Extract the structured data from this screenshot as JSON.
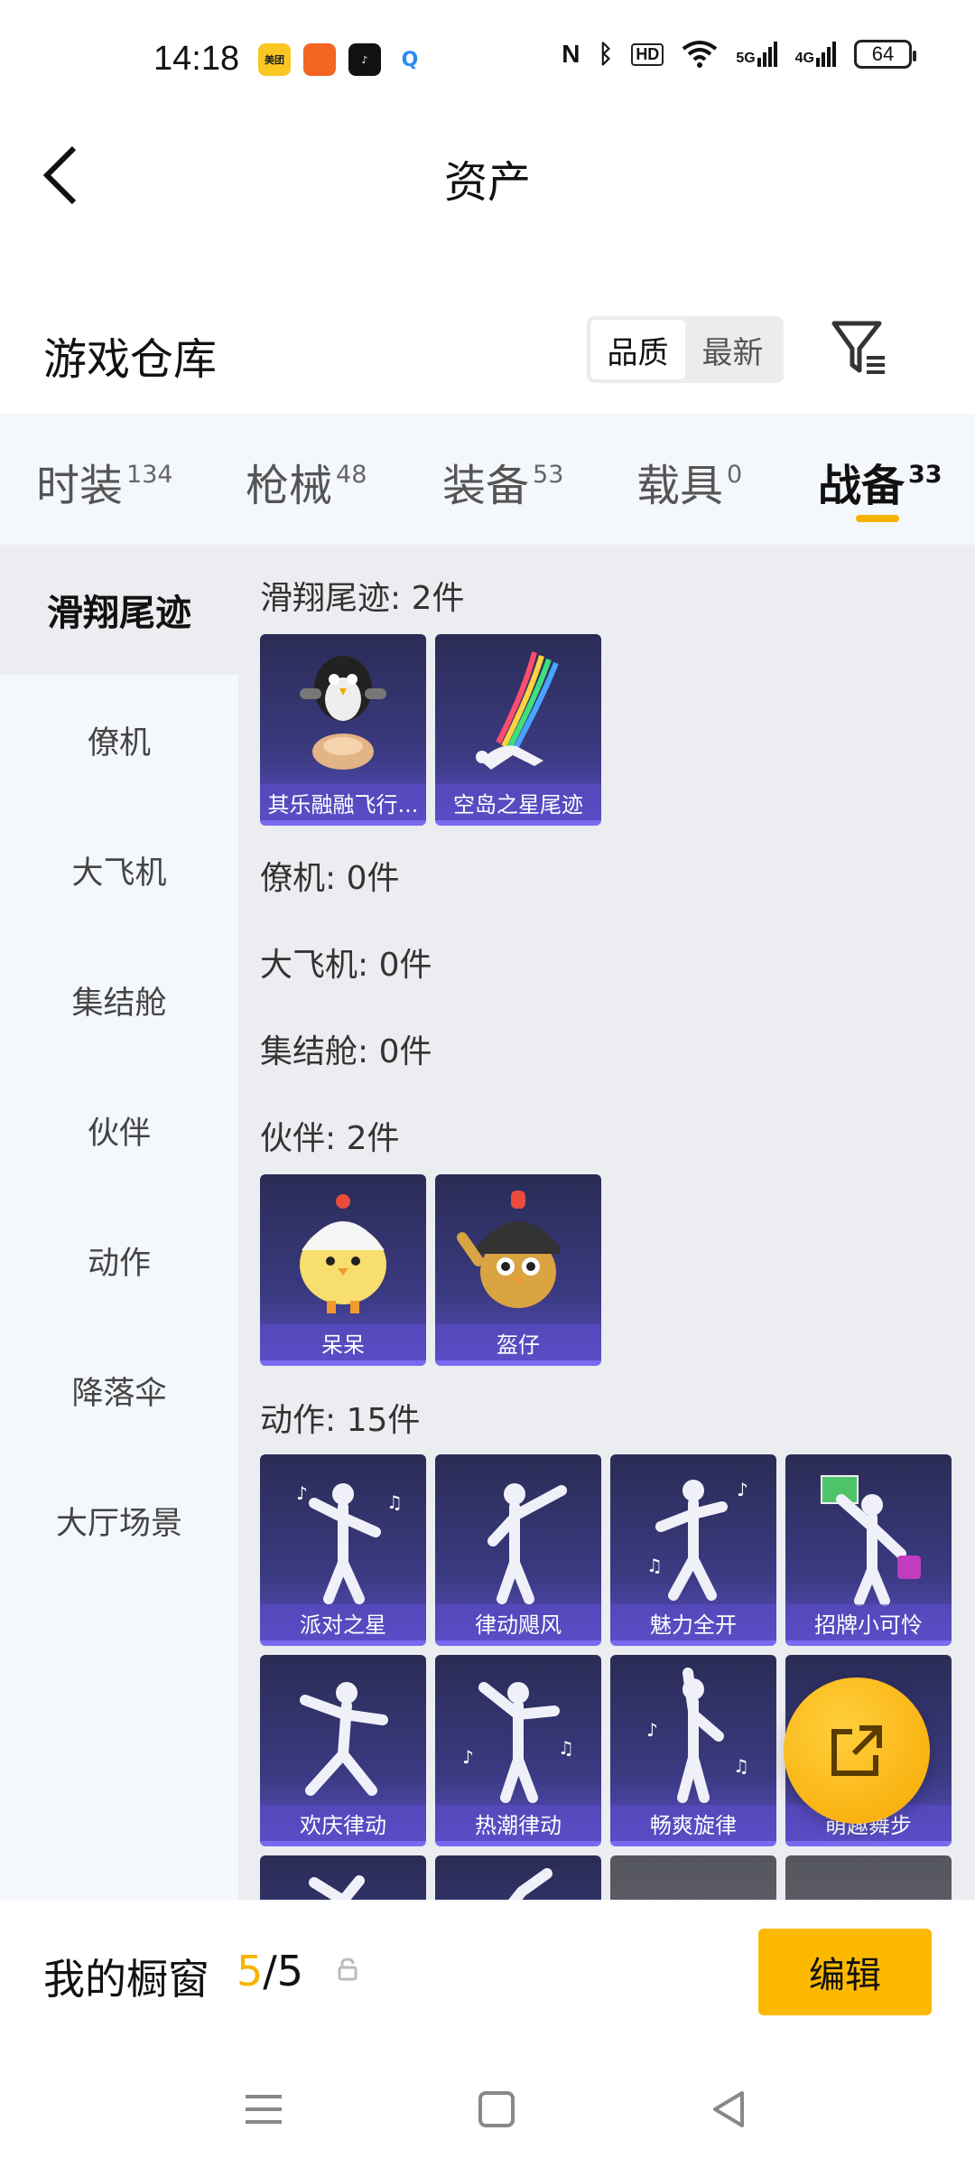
{
  "status_bar": {
    "time": "14:18",
    "app_icons": [
      "美团",
      "app-icon",
      "tiktok-icon",
      "search-app-icon"
    ],
    "signal_5g": "5G",
    "signal_4g": "4G",
    "battery": "64"
  },
  "header": {
    "title": "资产",
    "back_icon": "chevron-left-icon"
  },
  "warehouse": {
    "title": "游戏仓库",
    "sort_options": [
      "品质",
      "最新"
    ],
    "sort_selected": "品质",
    "filter_icon": "filter-icon"
  },
  "tabs": [
    {
      "label": "时装",
      "count": "134",
      "active": false
    },
    {
      "label": "枪械",
      "count": "48",
      "active": false
    },
    {
      "label": "装备",
      "count": "53",
      "active": false
    },
    {
      "label": "载具",
      "count": "0",
      "active": false
    },
    {
      "label": "战备",
      "count": "33",
      "active": true
    }
  ],
  "accent_color": "#f6b400",
  "subnav": [
    {
      "label": "滑翔尾迹",
      "active": true
    },
    {
      "label": "僚机",
      "active": false
    },
    {
      "label": "大飞机",
      "active": false
    },
    {
      "label": "集结舱",
      "active": false
    },
    {
      "label": "伙伴",
      "active": false
    },
    {
      "label": "动作",
      "active": false
    },
    {
      "label": "降落伞",
      "active": false
    },
    {
      "label": "大厅场景",
      "active": false
    }
  ],
  "sections": [
    {
      "title": "滑翔尾迹: 2件",
      "items": [
        "其乐融融飞行...",
        "空岛之星尾迹"
      ]
    },
    {
      "title": "僚机: 0件",
      "items": []
    },
    {
      "title": "大飞机: 0件",
      "items": []
    },
    {
      "title": "集结舱: 0件",
      "items": []
    },
    {
      "title": "伙伴: 2件",
      "items": [
        "呆呆",
        "盔仔"
      ]
    },
    {
      "title": "动作: 15件",
      "items": [
        "派对之星",
        "律动飓风",
        "魅力全开",
        "招牌小可怜",
        "欢庆律动",
        "热潮律动",
        "畅爽旋律",
        "萌趣舞步"
      ]
    }
  ],
  "fab_icon": "share-external-icon",
  "bottom_bar": {
    "label": "我的橱窗",
    "current": "5",
    "separator": "/",
    "total": "5",
    "lock_icon": "lock-icon",
    "edit_label": "编辑"
  },
  "navbar": {
    "menu_icon": "menu-icon",
    "home_icon": "home-square-icon",
    "back_icon": "back-triangle-icon"
  }
}
